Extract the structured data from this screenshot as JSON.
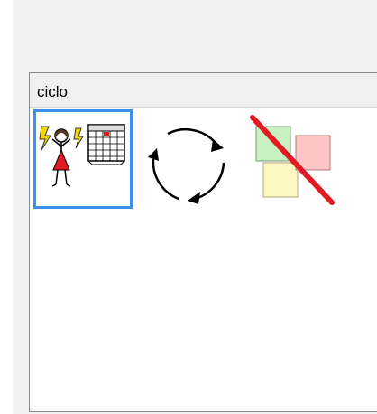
{
  "panel": {
    "title": "ciclo"
  },
  "symbols": [
    {
      "icon": "woman-calendar-icon",
      "selected": true
    },
    {
      "icon": "cycle-arrows-icon",
      "selected": false
    },
    {
      "icon": "no-colors-icon",
      "selected": false
    }
  ],
  "colors": {
    "selection": "#3a92f0",
    "header": "#f0f0f0",
    "strike": "#e01b24"
  }
}
